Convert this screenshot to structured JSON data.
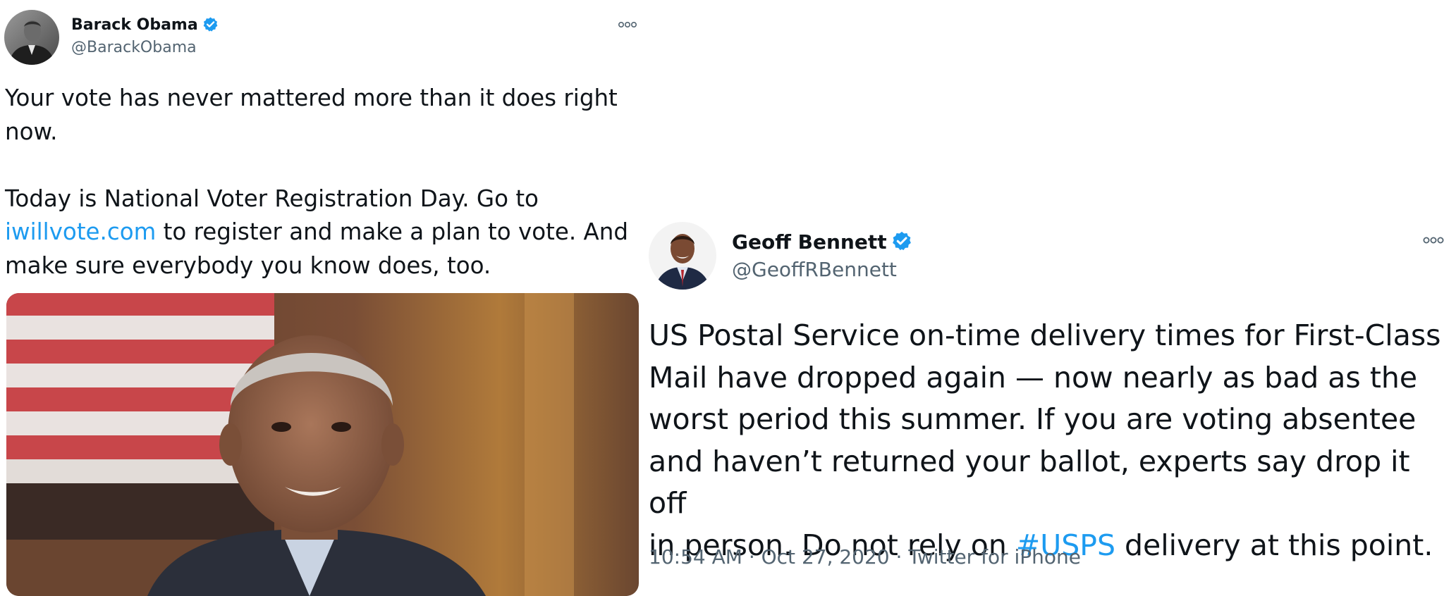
{
  "tweets": [
    {
      "author": {
        "name": "Barack Obama",
        "handle": "@BarackObama",
        "verified": true
      },
      "text": {
        "line1": "Your vote has never mattered more than it does right",
        "line2": "now.",
        "line3": "Today is National Voter Registration Day. Go to",
        "link": "iwillvote.com",
        "line4_after_link": " to register and make a plan to vote. And",
        "line5": "make sure everybody you know does, too."
      },
      "media": {
        "type": "video-still",
        "subject": "man speaking in front of an American flag"
      },
      "icons": {
        "more": "more-options-icon",
        "verified": "verified-badge-icon"
      }
    },
    {
      "author": {
        "name": "Geoff Bennett",
        "handle": "@GeoffRBennett",
        "verified": true
      },
      "text": {
        "line1": "US Postal Service on-time delivery times for First-Class",
        "line2": "Mail have dropped again — now nearly as bad as the",
        "line3": "worst period this summer. If you are voting absentee",
        "line4": "and haven’t returned your ballot, experts say drop it off",
        "line5_before_tag": "in person. Do not rely on ",
        "hashtag": "#USPS",
        "line5_after_tag": " delivery at this point."
      },
      "meta": {
        "time": "10:54 AM",
        "separator": "·",
        "date": "Oct 27, 2020",
        "source": "Twitter for iPhone"
      },
      "icons": {
        "more": "more-options-icon",
        "verified": "verified-badge-icon"
      }
    }
  ],
  "colors": {
    "link": "#1d9bf0",
    "verified": "#1d9bf0",
    "secondary_text": "#536471",
    "primary_text": "#0f1419"
  }
}
